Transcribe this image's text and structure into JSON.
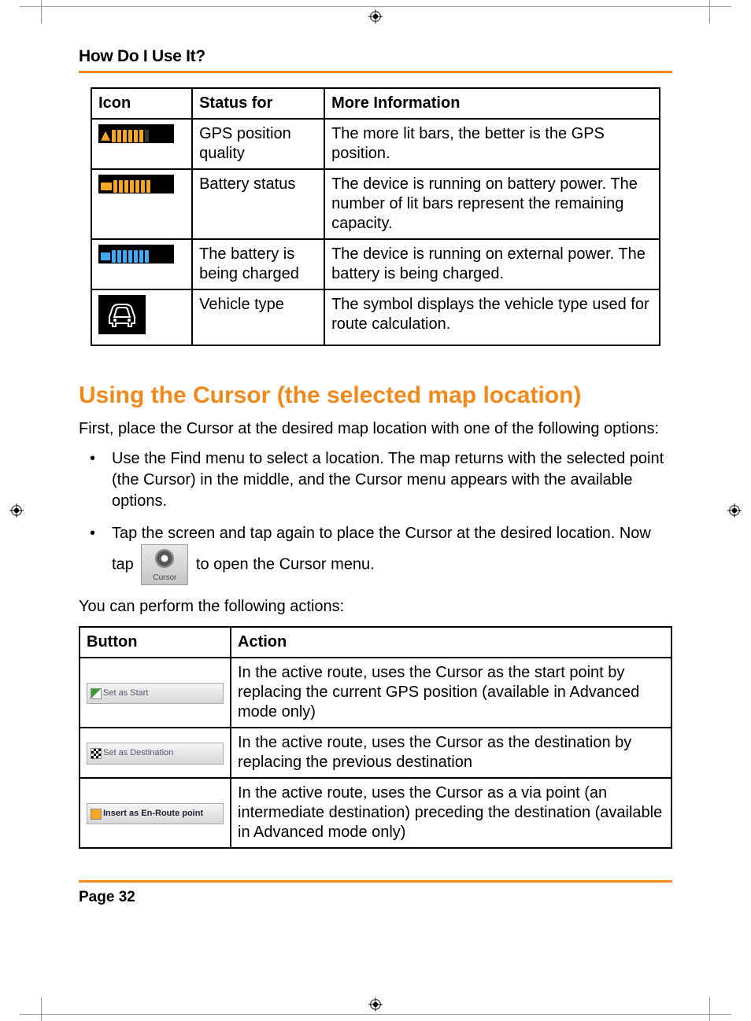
{
  "header": {
    "title": "How Do I Use It?"
  },
  "table1": {
    "headers": [
      "Icon",
      "Status for",
      "More Information"
    ],
    "rows": [
      {
        "status": "GPS position quality",
        "info": "The more lit bars, the better is the GPS position."
      },
      {
        "status": "Battery status",
        "info": "The device is running on battery power. The number of lit bars represent the remaining capacity."
      },
      {
        "status": "The battery is being charged",
        "info": " The device is running on external power. The battery is being charged."
      },
      {
        "status": "Vehicle type",
        "info": "The symbol displays the vehicle type used for route calculation."
      }
    ]
  },
  "section": {
    "title": "Using the Cursor (the selected map location)",
    "intro": "First, place the Cursor at the desired map location with one of the following options:",
    "bullet1": "Use the Find menu to select a location. The map returns with the selected point (the Cursor) in the middle, and the Cursor menu appears with the available options.",
    "bullet2a": "Tap the screen and tap again to place the Cursor at the desired location. Now tap ",
    "bullet2b": " to open the Cursor menu.",
    "cursor_label": "Cursor",
    "outro": "You can perform the following actions:"
  },
  "table2": {
    "headers": [
      "Button",
      "Action"
    ],
    "rows": [
      {
        "btn": "Set as Start",
        "action": "In the active route, uses the Cursor as the start point by replacing the current GPS position (available in Advanced mode only)"
      },
      {
        "btn": "Set as Destination",
        "action": "In the active route, uses the Cursor as the destination by replacing the previous destination"
      },
      {
        "btn": "Insert as En-Route point",
        "action": "In the active route, uses the Cursor as a via point (an intermediate destination) preceding the destination (available in Advanced mode only)"
      }
    ]
  },
  "footer": {
    "page": "Page 32"
  }
}
